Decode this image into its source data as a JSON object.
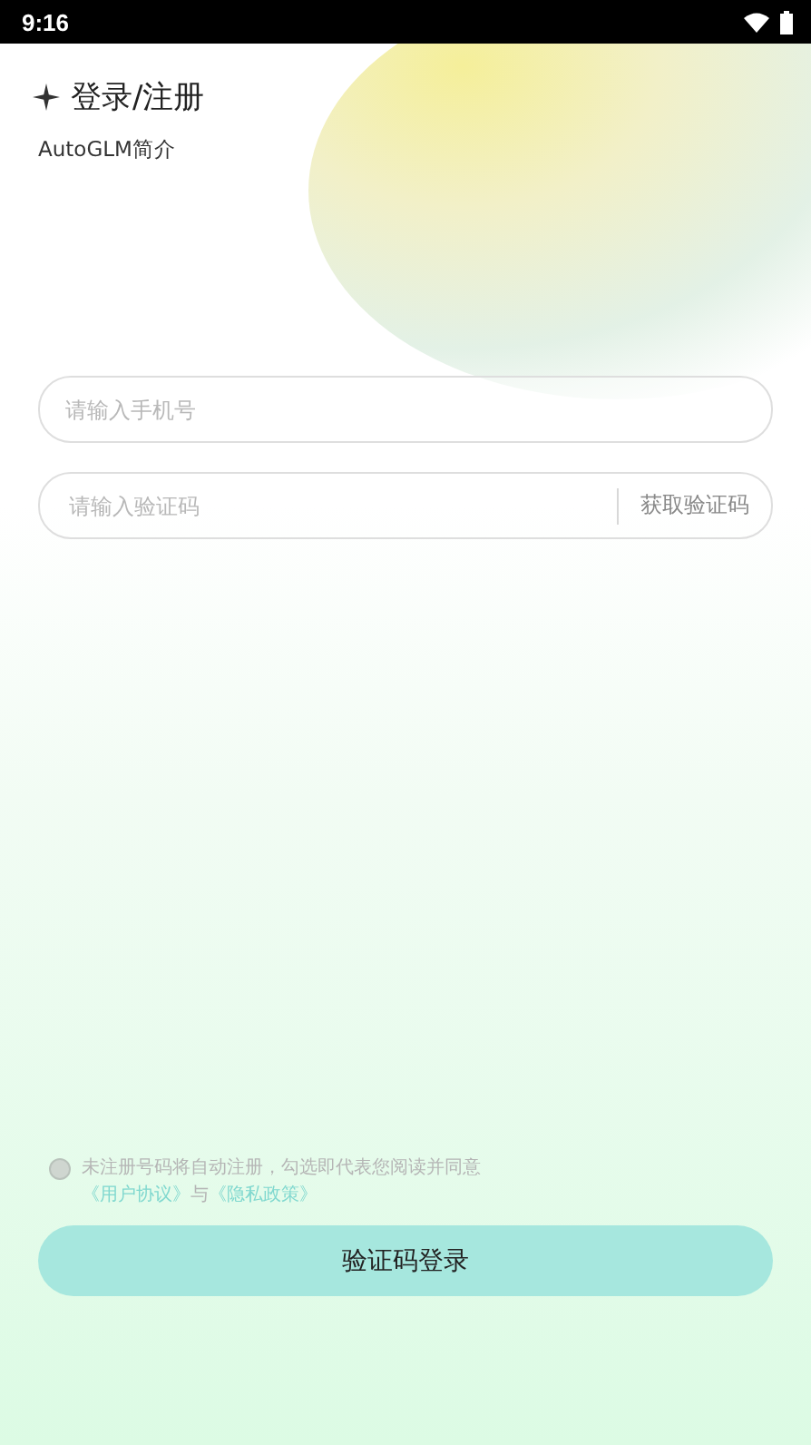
{
  "status_bar": {
    "time": "9:16"
  },
  "header": {
    "title": "登录/注册",
    "subtitle": "AutoGLM简介"
  },
  "phone_field": {
    "placeholder": "请输入手机号"
  },
  "code_field": {
    "placeholder": "请输入验证码",
    "action": "获取验证码"
  },
  "agreement": {
    "agreed": false,
    "text": "未注册号码将自动注册，勾选即代表您阅读并同意",
    "links": [
      {
        "kind": "link",
        "text": "《用户协议》"
      },
      {
        "kind": "plain",
        "text": "与"
      },
      {
        "kind": "link",
        "text": "《隐私政策》"
      }
    ]
  },
  "submit_button": {
    "label": "验证码登录"
  }
}
